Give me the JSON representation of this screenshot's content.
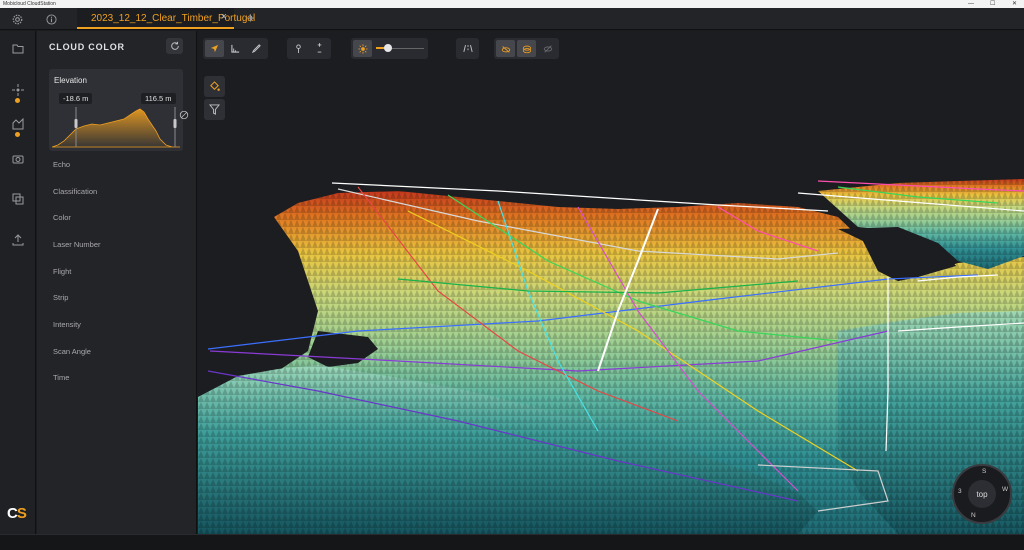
{
  "window": {
    "title": "Mobicloud CloudStation",
    "controls": [
      "—",
      "☐",
      "✕"
    ]
  },
  "tabs": {
    "active_label": "2023_12_12_Clear_Timber_Portugal",
    "close_glyph": "×",
    "add_glyph": "+"
  },
  "rail": {
    "icons": [
      "folder-icon",
      "trajectory-icon",
      "processing-icon",
      "camera-icon",
      "layers-icon",
      "export-icon"
    ],
    "logo_c": "C",
    "logo_s": "S",
    "accent": "#f0a020"
  },
  "panel": {
    "title": "CLOUD COLOR",
    "elevation": {
      "label": "Elevation",
      "min": "-18.6 m",
      "max": "116.5 m"
    },
    "modes": [
      "Echo",
      "Classification",
      "Color",
      "Laser Number",
      "Flight",
      "Strip",
      "Intensity",
      "Scan Angle",
      "Time"
    ]
  },
  "toolbar": {
    "brightness_level": 0.25,
    "compass_top": "top",
    "compass_letters": {
      "s": "S",
      "w": "W",
      "n": "N",
      "e": "3"
    }
  },
  "colors": {
    "accent": "#f0a020",
    "background": "#1c1d21",
    "panel": "#232428"
  }
}
